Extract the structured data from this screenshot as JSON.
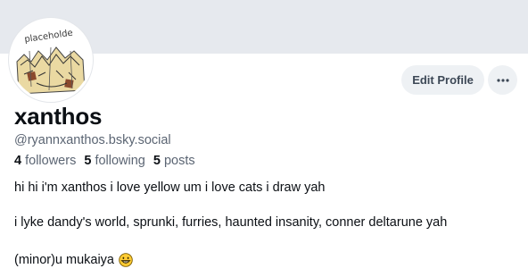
{
  "profile": {
    "avatar_text": "placeholde",
    "display_name": "xanthos",
    "handle": "@ryannxanthos.bsky.social",
    "stats": {
      "followers_count": "4",
      "followers_label": "followers",
      "following_count": "5",
      "following_label": "following",
      "posts_count": "5",
      "posts_label": "posts"
    },
    "bio": {
      "line1": "hi hi i'm xanthos i love yellow um i love cats i draw yah",
      "line2": "i lyke dandy's world, sprunki, furries, haunted insanity, conner deltarune yah",
      "line3": "(minor)u mukaiya",
      "line3_emoji": "grinning-face-emoji"
    }
  },
  "actions": {
    "edit_profile_label": "Edit Profile",
    "more_icon": "ellipsis-icon"
  }
}
